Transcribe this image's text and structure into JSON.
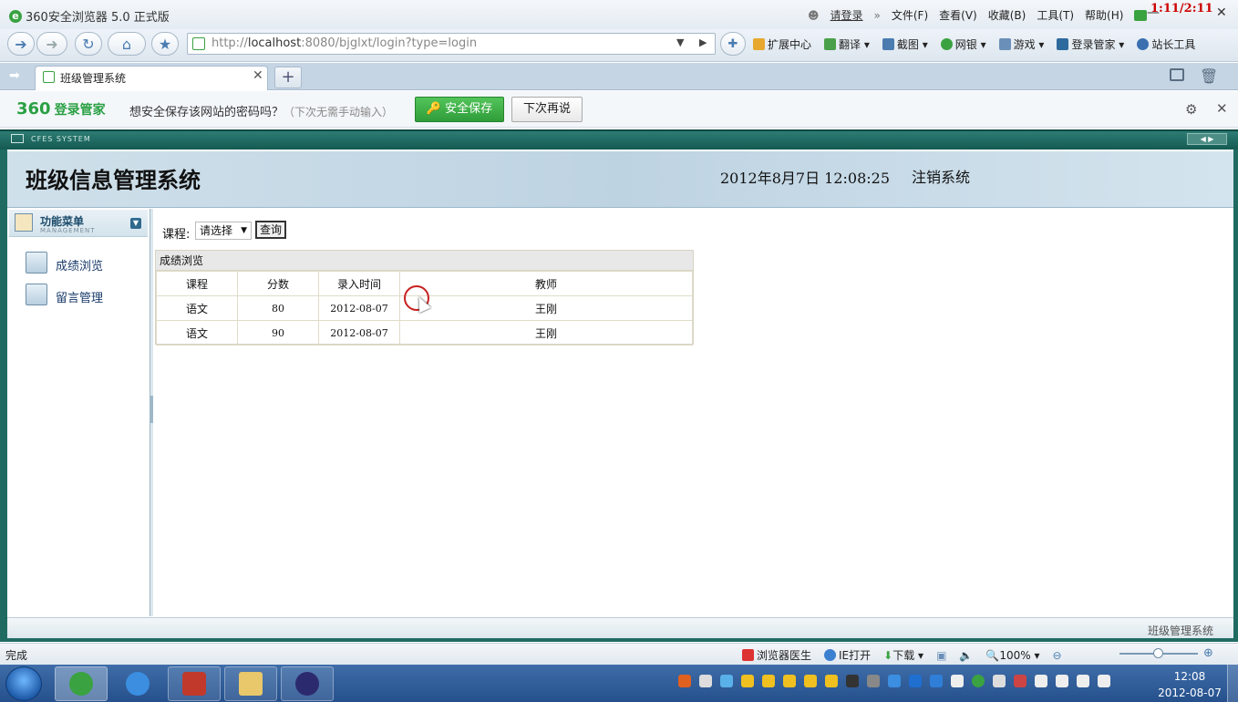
{
  "browser": {
    "app_title": "360安全浏览器 5.0 正式版",
    "login": "请登录",
    "menus": [
      "文件(F)",
      "查看(V)",
      "收藏(B)",
      "工具(T)",
      "帮助(H)"
    ],
    "overlay_time": "1:11/2:11",
    "url_prefix": "http://",
    "url_host": "localhost",
    "url_rest": ":8080/bjglxt/login?type=login",
    "tools": [
      "扩展中心",
      "翻译",
      "截图",
      "网银",
      "游戏",
      "登录管家",
      "站长工具"
    ],
    "tab_label": "班级管理系统",
    "tab_new": "+"
  },
  "password_bar": {
    "brand": "360",
    "brand_name": "登录管家",
    "question": "想安全保存该网站的密码吗？",
    "hint": "（下次无需手动输入）",
    "save_label": "安全保存",
    "later_label": "下次再说"
  },
  "frame": {
    "label": "CFES SYSTEM"
  },
  "header": {
    "system_title": "班级信息管理系统",
    "datetime": "2012年8月7日  12:08:25",
    "logout": "注销系统"
  },
  "sidebar": {
    "menu_title": "功能菜单",
    "menu_subtitle": "MANAGEMENT",
    "items": [
      {
        "label": "成绩浏览"
      },
      {
        "label": "留言管理"
      }
    ]
  },
  "filter": {
    "label": "课程:",
    "selected": "请选择",
    "query_label": "查询"
  },
  "grades_table": {
    "caption": "成绩浏览",
    "columns": [
      "课程",
      "分数",
      "录入时间",
      "教师"
    ],
    "rows": [
      [
        "语文",
        "80",
        "2012-08-07",
        "王刚"
      ],
      [
        "语文",
        "90",
        "2012-08-07",
        "王刚"
      ]
    ]
  },
  "page_footer": {
    "label": "班级管理系统"
  },
  "status_bar": {
    "status": "完成",
    "doctor": "浏览器医生",
    "ie_open": "IE打开",
    "download": "下载",
    "zoom": "100%"
  },
  "taskbar": {
    "time": "12:08",
    "date": "2012-08-07"
  },
  "colors": {
    "brand_green": "#2aa043",
    "frame_teal": "#1f6b62",
    "banner_blue": "#cfe0ea",
    "cursor_ring": "#c82020"
  }
}
